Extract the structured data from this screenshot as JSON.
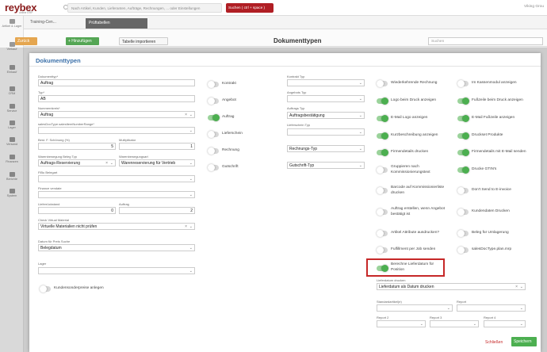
{
  "header": {
    "logo": "reybex",
    "logo_sub": "online ERP",
    "search_placeholder": "Nach Artikel, Kunden, Lieferanten, Aufträge, Rechnungen, ... oder Einstellungen",
    "search_button": "Suchen ( ctrl + space )",
    "user": "Viking Grou"
  },
  "sidenav": [
    {
      "label": "Artikel & Lager"
    },
    {
      "label": "Verkauf"
    },
    {
      "label": "Einkauf"
    },
    {
      "label": "CRM"
    },
    {
      "label": "Service"
    },
    {
      "label": "Lager"
    },
    {
      "label": "Versand"
    },
    {
      "label": "Finanzen"
    },
    {
      "label": "Berichte"
    },
    {
      "label": "System"
    }
  ],
  "tabs": {
    "tab1": "Training-Cen...",
    "tab2": "Prüftabellen"
  },
  "toolbar": {
    "back": "Zurück",
    "add": "+ Hinzufügen",
    "import": "Tabelle importieren",
    "title": "Dokumenttypen",
    "search_placeholder": "Suchen"
  },
  "modal": {
    "title": "Dokumenttypen",
    "dokumenttyp_label": "Dokumenttyp*",
    "dokumenttyp_value": "Auftrag",
    "typ_label": "Typ*",
    "typ_value": "AB",
    "nummernkreis_label": "Nummernkreis*",
    "nummernkreis_value": "Auftrag",
    "salesdoc_label": "salesDocType.salesItemNumberRange*",
    "schoenung_label": "Best. F. Schönung (%)",
    "schoenung_value": "5",
    "multiplikator_label": "Multiplikator",
    "multiplikator_value": "1",
    "wbbeleg_label": "Warenbewegung Beleg Typ",
    "wbbeleg_value": "Auftrags-Reservierung",
    "wbart_label": "Warenbewegungsart",
    "wbart_value": "Warenreservierung für Vertrieb",
    "fibu_label": "FiBu Belegart",
    "finance_label": "Finance vendate",
    "lieferrueck_label": "Lieferrückstand",
    "lieferrueck_value": "0",
    "auftrag_label": "Auftrag",
    "auftrag_value": "2",
    "virtual_label": "Check Virtual Material",
    "virtual_value": "Virtuelle Materialien nicht prüfen",
    "datum_label": "Datum für Preis Suche",
    "datum_value": "Belegdatum",
    "lager_label": "Lager",
    "kunden_toggle": "Kundensonderpreise anlegen",
    "kontrakt_typ_label": "Kontrakt Typ",
    "angebot_typ_label": "Angebots Typ",
    "auftrag_typ_label": "Auftrags Typ",
    "auftrag_typ_value": "Auftragsbestätigung",
    "lieferschein_typ_label": "Lieferschein Typ",
    "rechnungs_typ_value": "Rechnungs-Typ",
    "gutschrift_typ_value": "Gutschrift-Typ",
    "lieferdatum_label": "Lieferdatum drucken",
    "lieferdatum_value": "Lieferdatum als Datum drucken",
    "standardartikel_label": "Standardartikel(e)",
    "report_label": "Report",
    "report2_label": "Report 2",
    "report3_label": "Report 3",
    "report4_label": "Report 4",
    "close": "Schließen",
    "save": "Speichern"
  },
  "toggles_col2": [
    {
      "label": "Kontrakt",
      "on": false
    },
    {
      "label": "Angebot",
      "on": false
    },
    {
      "label": "Auftrag",
      "on": true
    },
    {
      "label": "Lieferschein",
      "on": false
    },
    {
      "label": "Rechnung",
      "on": false
    },
    {
      "label": "Gutschrift",
      "on": false
    }
  ],
  "toggles_col4": [
    {
      "label": "Wiederkehrende Rechnung",
      "on": false
    },
    {
      "label": "Logo beim Druck anzeigen",
      "on": true
    },
    {
      "label": "E-Mail Logo anzeigen",
      "on": true
    },
    {
      "label": "Kurzbeschreibung anzeigen",
      "on": true
    },
    {
      "label": "Firmendetails drucken",
      "on": true
    },
    {
      "label": "Gruppieren nach Kommissionierungstext",
      "on": false
    },
    {
      "label": "Barcode auf Kommissionierliste drucken",
      "on": false
    },
    {
      "label": "Auftrag erstellen, wenn Angebot bestätigt ist",
      "on": false
    },
    {
      "label": "Artikel Attribute ausdrucken?",
      "on": false
    },
    {
      "label": "Fulfillment per Job senden",
      "on": false
    },
    {
      "label": "Berechne Lieferdatum für Position",
      "on": true
    }
  ],
  "toggles_col5": [
    {
      "label": "Im Kassenmodul anzeigen",
      "on": false
    },
    {
      "label": "Fußzeile beim Druck anzeigen",
      "on": true
    },
    {
      "label": "E-Mail Fußzeile anzeigen",
      "on": true
    },
    {
      "label": "Druckset Produkte",
      "on": true
    },
    {
      "label": "Firmendetails mit E-Mail senden",
      "on": true
    },
    {
      "label": "Drucke GTIN's",
      "on": true
    },
    {
      "label": "Don't Send to E-invoice",
      "on": false
    },
    {
      "label": "Kundendaten Drucken",
      "on": false
    },
    {
      "label": "Beleg für Umlagerung",
      "on": false
    },
    {
      "label": "salesDocType.plan.mrp",
      "on": false
    }
  ]
}
